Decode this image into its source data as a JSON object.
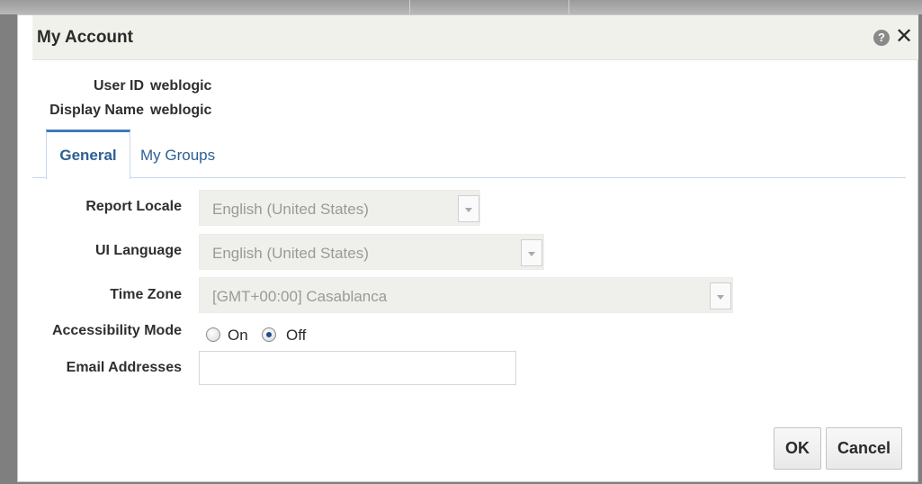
{
  "dialog": {
    "title": "My Account",
    "help_icon": "help-icon",
    "close_icon": "close-icon",
    "close_glyph": "✕",
    "help_glyph": "?"
  },
  "user": {
    "user_id_label": "User ID",
    "user_id_value": "weblogic",
    "display_name_label": "Display Name",
    "display_name_value": "weblogic"
  },
  "tabs": [
    {
      "label": "General",
      "active": true
    },
    {
      "label": "My Groups",
      "active": false
    }
  ],
  "form": {
    "report_locale": {
      "label": "Report Locale",
      "value": "English (United States)"
    },
    "ui_language": {
      "label": "UI Language",
      "value": "English (United States)"
    },
    "time_zone": {
      "label": "Time Zone",
      "value": "[GMT+00:00] Casablanca"
    },
    "accessibility": {
      "label": "Accessibility Mode",
      "options": [
        {
          "label": "On",
          "checked": false
        },
        {
          "label": "Off",
          "checked": true
        }
      ]
    },
    "email": {
      "label": "Email Addresses",
      "value": "",
      "placeholder": ""
    }
  },
  "buttons": {
    "ok": "OK",
    "cancel": "Cancel"
  },
  "colors": {
    "tab_accent": "#3e7ab5",
    "tab_text": "#2d5f93",
    "titlebar_bg": "#f1f1ec"
  }
}
